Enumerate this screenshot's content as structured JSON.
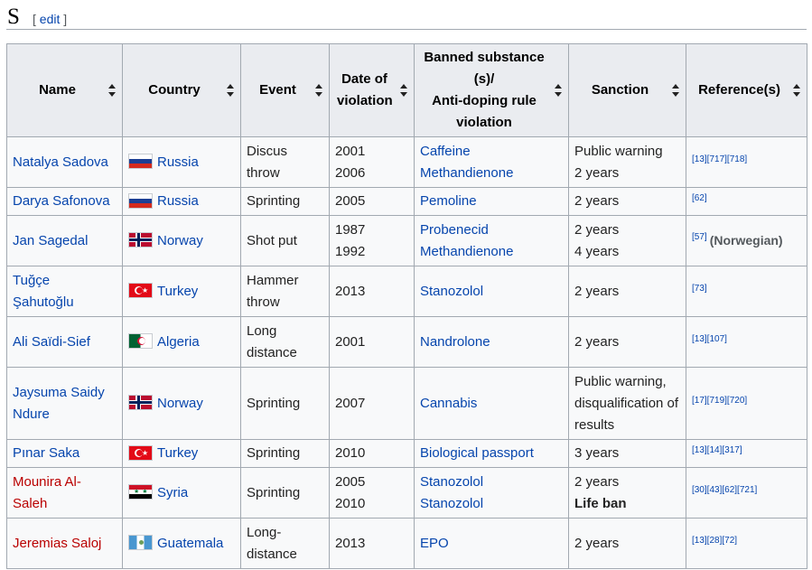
{
  "section": {
    "title": "S",
    "edit_open": "[",
    "edit_label": "edit",
    "edit_close": "]"
  },
  "table": {
    "headers": {
      "name": "Name",
      "country": "Country",
      "event": "Event",
      "date_l1": "Date of",
      "date_l2": "violation",
      "sub_l1": "Banned substance",
      "sub_l2": "(s)/",
      "sub_l3": "Anti-doping rule",
      "sub_l4": "violation",
      "sanction": "Sanction",
      "refs": "Reference(s)"
    },
    "rows": [
      {
        "name": "Natalya Sadova",
        "country": "Russia",
        "event": "Discus throw",
        "date1": "2001",
        "date2": "2006",
        "sub1": "Caffeine",
        "sub2": "Methandienone",
        "sanc1": "Public warning",
        "sanc2": "2 years",
        "refs": "[13][717][718]"
      },
      {
        "name": "Darya Safonova",
        "country": "Russia",
        "event": "Sprinting",
        "date1": "2005",
        "sub1": "Pemoline",
        "sanc1": "2 years",
        "refs": "[62]"
      },
      {
        "name": "Jan Sagedal",
        "country": "Norway",
        "event": "Shot put",
        "date1": "1987",
        "date2": "1992",
        "sub1": "Probenecid",
        "sub2": "Methandienone",
        "sanc1": "2 years",
        "sanc2": "4 years",
        "refs": "[57]",
        "ref_note": "(Norwegian)"
      },
      {
        "name_l1": "Tuğçe",
        "name_l2": "Şahutoğlu",
        "country": "Turkey",
        "event_l1": "Hammer",
        "event_l2": "throw",
        "date1": "2013",
        "sub1": "Stanozolol",
        "sanc1": "2 years",
        "refs": "[73]"
      },
      {
        "name": "Ali Saïdi-Sief",
        "country": "Algeria",
        "event_l1": "Long",
        "event_l2": "distance",
        "date1": "2001",
        "sub1": "Nandrolone",
        "sanc1": "2 years",
        "refs": "[13][107]"
      },
      {
        "name_l1": "Jaysuma Saidy",
        "name_l2": "Ndure",
        "country": "Norway",
        "event": "Sprinting",
        "date1": "2007",
        "sub1": "Cannabis",
        "sanc_l1": "Public warning,",
        "sanc_l2": "disqualification of",
        "sanc_l3": "results",
        "refs": "[17][719][720]"
      },
      {
        "name": "Pınar Saka",
        "country": "Turkey",
        "event": "Sprinting",
        "date1": "2010",
        "sub1": "Biological passport",
        "sanc1": "3 years",
        "refs": "[13][14][317]"
      },
      {
        "name_l1": "Mounira Al-",
        "name_l2": "Saleh",
        "country": "Syria",
        "event": "Sprinting",
        "date1": "2005",
        "date2": "2010",
        "sub1": "Stanozolol",
        "sub2": "Stanozolol",
        "sanc1": "2 years",
        "sanc2": "Life ban",
        "refs": "[30][43][62][721]"
      },
      {
        "name": "Jeremias Saloj",
        "country": "Guatemala",
        "event_l1": "Long-",
        "event_l2": "distance",
        "date1": "2013",
        "sub1": "EPO",
        "sanc1": "2 years",
        "refs": "[13][28][72]"
      }
    ]
  },
  "colors": {
    "link": "#0645ad",
    "redlink": "#ba0000",
    "header_bg": "#eaecf0",
    "cell_bg": "#f8f9fa",
    "border": "#a2a9b1"
  }
}
